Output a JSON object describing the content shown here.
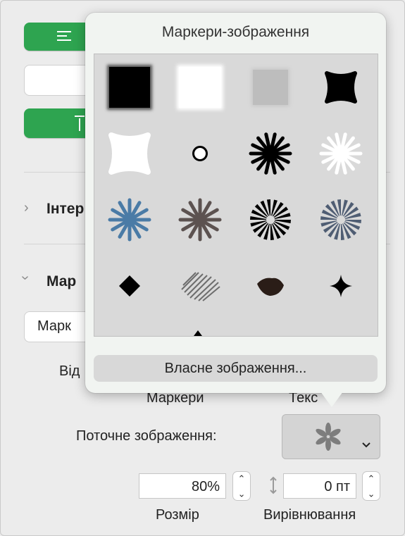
{
  "popover": {
    "title": "Маркери-зображення",
    "custom_button": "Власне зображення...",
    "bullets": [
      "black-square",
      "white-square",
      "gray-square",
      "black-curved-square",
      "white-curved-square",
      "small-ring",
      "black-starburst",
      "white-starburst",
      "blue-starburst",
      "brown-starburst",
      "black-radial-burst",
      "blue-gray-radial-burst",
      "black-diamond",
      "scribble-diamond",
      "brown-blob",
      "black-four-point-star"
    ]
  },
  "sidebar": {
    "section1_label": "Інтер",
    "section2_label": "Мар",
    "dropdown_text": "Марк",
    "partial_label": "Від",
    "markers_label": "Маркери",
    "text_label": "Текс"
  },
  "current_image": {
    "label": "Поточне зображення:"
  },
  "size": {
    "value": "80%",
    "caption": "Розмір"
  },
  "alignment": {
    "value": "0 пт",
    "caption": "Вирівнювання"
  }
}
